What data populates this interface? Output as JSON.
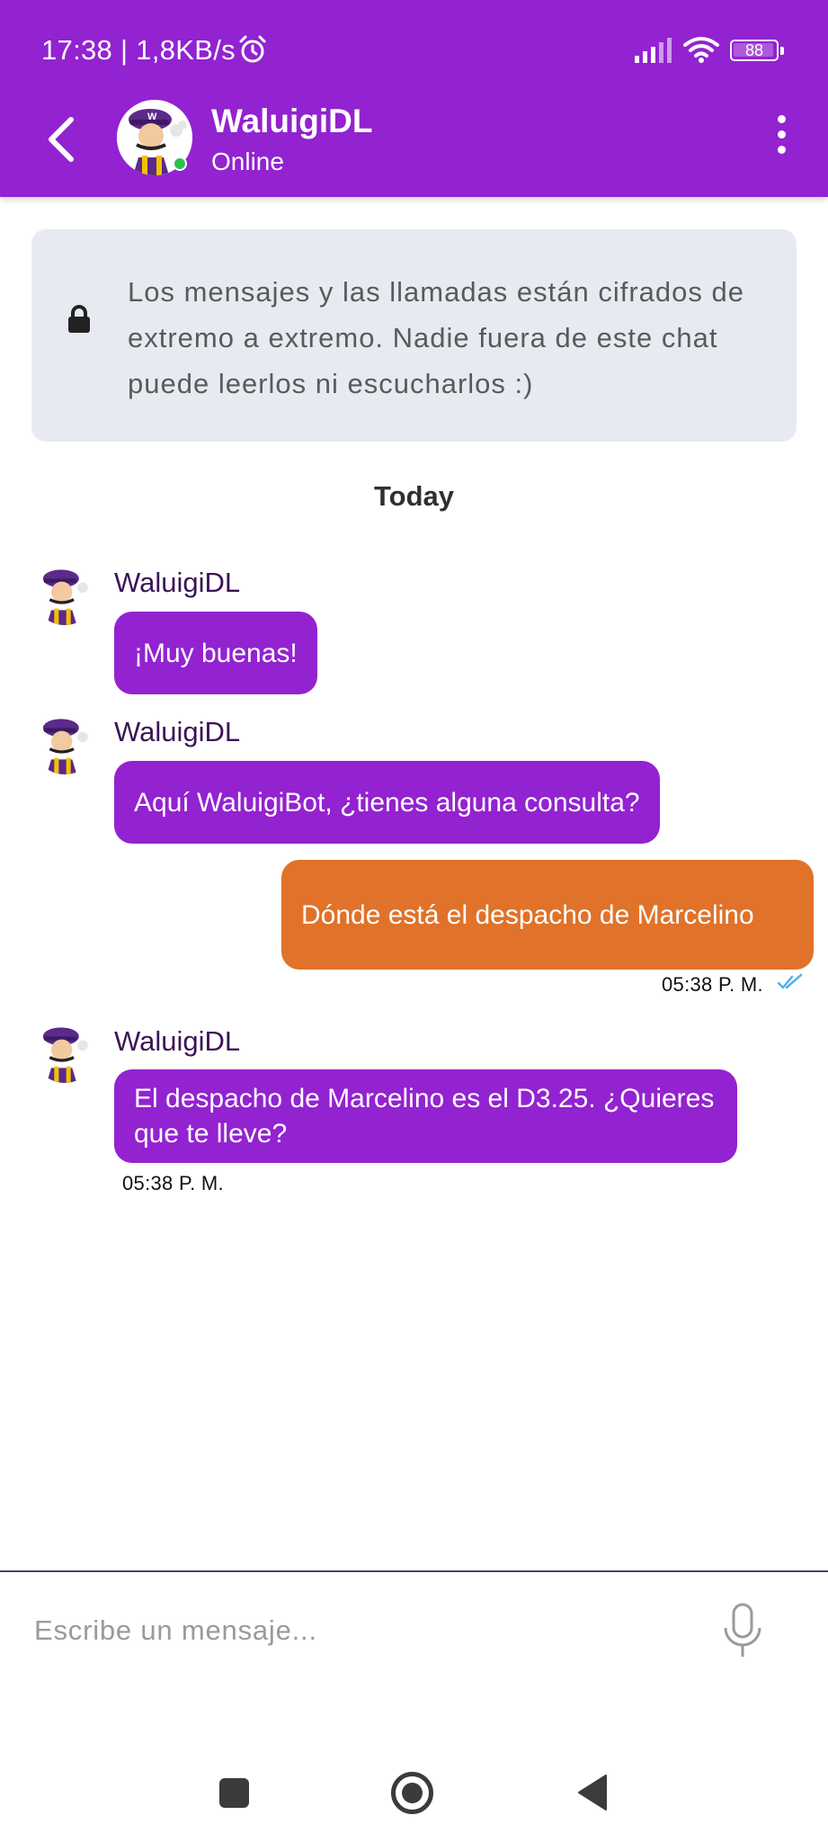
{
  "status_bar": {
    "time_speed": "17:38 | 1,8KB/s",
    "battery": "88",
    "icons": [
      "alarm-icon",
      "signal-icon",
      "wifi-icon",
      "battery-icon"
    ]
  },
  "header": {
    "contact_name": "WaluigiDL",
    "contact_status": "Online",
    "icons": [
      "back-arrow-icon",
      "avatar",
      "more-vert-icon"
    ]
  },
  "notice": {
    "text": "Los mensajes y las llamadas están cifrados de extremo a extremo. Nadie fuera de este chat puede leerlos ni escucharlos :)",
    "icon": "lock-icon"
  },
  "day_divider": "Today",
  "messages": [
    {
      "direction": "incoming",
      "sender": "WaluigiDL",
      "text": "¡Muy buenas!"
    },
    {
      "direction": "incoming",
      "sender": "WaluigiDL",
      "text": "Aquí WaluigiBot, ¿tienes alguna consulta?"
    },
    {
      "direction": "outgoing",
      "text": "Dónde está el despacho de Marcelino",
      "time": "05:38 P. M.",
      "status_icon": "double-check-icon"
    },
    {
      "direction": "incoming",
      "sender": "WaluigiDL",
      "text": "El despacho de Marcelino es el D3.25. ¿Quieres que te lleve?",
      "time": "05:38 P. M."
    }
  ],
  "composer": {
    "placeholder": "Escribe un mensaje...",
    "icon": "microphone-icon"
  },
  "nav_bar": {
    "icons": [
      "recents-icon",
      "home-icon",
      "back-icon"
    ]
  },
  "colors": {
    "brand_purple": "#9322d1",
    "outgoing_orange": "#e07229",
    "notice_background": "#e8eaf2",
    "read_tick_blue": "#4fb3e8"
  }
}
